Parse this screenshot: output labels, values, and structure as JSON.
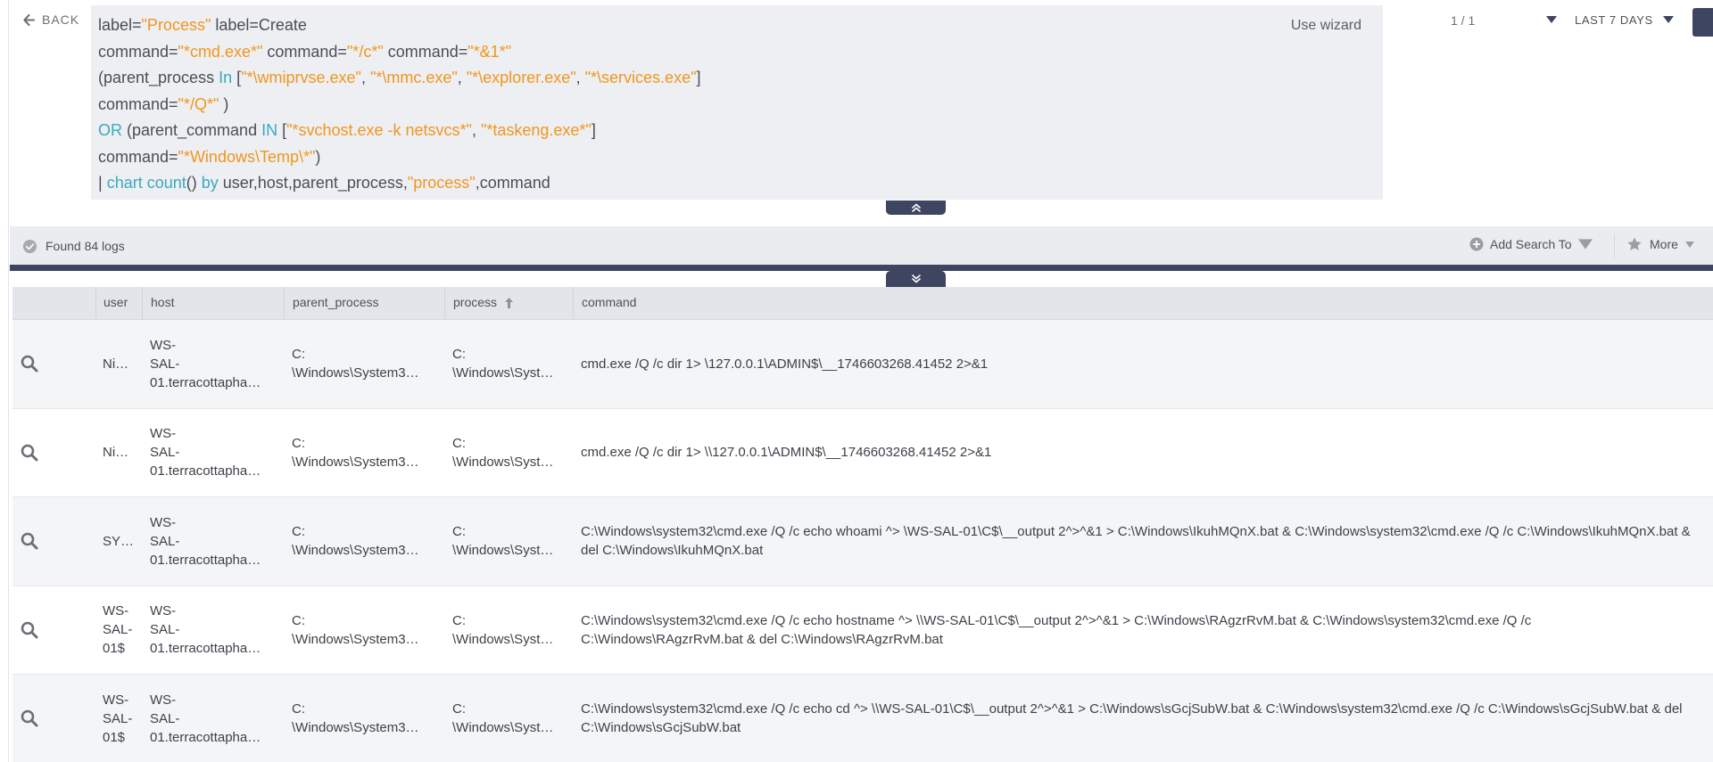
{
  "nav": {
    "back_label": "BACK"
  },
  "query": {
    "use_wizard_label": "Use wizard",
    "lines": [
      [
        {
          "t": "label=",
          "c": "plain"
        },
        {
          "t": "\"Process\"",
          "c": "str"
        },
        {
          "t": " label=Create",
          "c": "plain"
        }
      ],
      [
        {
          "t": "command=",
          "c": "plain"
        },
        {
          "t": "\"*cmd.exe*\"",
          "c": "str"
        },
        {
          "t": " command=",
          "c": "plain"
        },
        {
          "t": "\"*/c*\"",
          "c": "str"
        },
        {
          "t": " command=",
          "c": "plain"
        },
        {
          "t": "\"*&1*\"",
          "c": "str"
        }
      ],
      [
        {
          "t": "(parent_process ",
          "c": "plain"
        },
        {
          "t": "In",
          "c": "kw"
        },
        {
          "t": " [",
          "c": "plain"
        },
        {
          "t": "\"*\\wmiprvse.exe\"",
          "c": "str"
        },
        {
          "t": ", ",
          "c": "plain"
        },
        {
          "t": "\"*\\mmc.exe\"",
          "c": "str"
        },
        {
          "t": ", ",
          "c": "plain"
        },
        {
          "t": "\"*\\explorer.exe\"",
          "c": "str"
        },
        {
          "t": ", ",
          "c": "plain"
        },
        {
          "t": "\"*\\services.exe\"",
          "c": "str"
        },
        {
          "t": "]",
          "c": "plain"
        }
      ],
      [
        {
          "t": "command=",
          "c": "plain"
        },
        {
          "t": "\"*/Q*\"",
          "c": "str"
        },
        {
          "t": " )",
          "c": "plain"
        }
      ],
      [
        {
          "t": "OR",
          "c": "kw"
        },
        {
          "t": " (parent_command ",
          "c": "plain"
        },
        {
          "t": "IN",
          "c": "kw"
        },
        {
          "t": " [",
          "c": "plain"
        },
        {
          "t": "\"*svchost.exe -k netsvcs*\"",
          "c": "str"
        },
        {
          "t": ", ",
          "c": "plain"
        },
        {
          "t": "\"*taskeng.exe*\"",
          "c": "str"
        },
        {
          "t": "]",
          "c": "plain"
        }
      ],
      [
        {
          "t": "command=",
          "c": "plain"
        },
        {
          "t": "\"*Windows\\Temp\\*\"",
          "c": "str"
        },
        {
          "t": ")",
          "c": "plain"
        }
      ],
      [
        {
          "t": "| ",
          "c": "plain"
        },
        {
          "t": "chart count",
          "c": "kw"
        },
        {
          "t": "() ",
          "c": "plain"
        },
        {
          "t": "by",
          "c": "kw"
        },
        {
          "t": " user,host,parent_process,",
          "c": "plain"
        },
        {
          "t": "\"process\"",
          "c": "str"
        },
        {
          "t": ",command",
          "c": "plain"
        }
      ]
    ]
  },
  "pager": {
    "label": "1 / 1"
  },
  "time_range": {
    "label": "LAST 7 DAYS"
  },
  "results": {
    "found_label": "Found 84 logs",
    "add_search_label": "Add Search To",
    "more_label": "More"
  },
  "table": {
    "columns": [
      "",
      "user",
      "host",
      "parent_process",
      "process",
      "command"
    ],
    "sorted_column": "process",
    "rows": [
      {
        "user": "Ni…",
        "host": "WS-\nSAL-\n01.terracottapha…",
        "parent_process": "C:\n\\Windows\\System3…",
        "process": "C:\n\\Windows\\Syst…",
        "command": "cmd.exe /Q /c dir 1> \\127.0.0.1\\ADMIN$\\__1746603268.41452 2>&1"
      },
      {
        "user": "Ni…",
        "host": "WS-\nSAL-\n01.terracottapha…",
        "parent_process": "C:\n\\Windows\\System3…",
        "process": "C:\n\\Windows\\Syst…",
        "command": "cmd.exe /Q /c dir 1> \\\\127.0.0.1\\ADMIN$\\__1746603268.41452 2>&1"
      },
      {
        "user": "SY…",
        "host": "WS-\nSAL-\n01.terracottapha…",
        "parent_process": "C:\n\\Windows\\System3…",
        "process": "C:\n\\Windows\\Syst…",
        "command": "C:\\Windows\\system32\\cmd.exe /Q /c echo whoami ^> \\WS-SAL-01\\C$\\__output 2^>^&1 > C:\\Windows\\IkuhMQnX.bat & C:\\Windows\\system32\\cmd.exe /Q /c C:\\Windows\\IkuhMQnX.bat & del C:\\Windows\\IkuhMQnX.bat"
      },
      {
        "user": "WS-\nSAL-\n01$",
        "host": "WS-\nSAL-\n01.terracottapha…",
        "parent_process": "C:\n\\Windows\\System3…",
        "process": "C:\n\\Windows\\Syst…",
        "command": "C:\\Windows\\system32\\cmd.exe /Q /c echo hostname ^> \\\\WS-SAL-01\\C$\\__output 2^>^&1 > C:\\Windows\\RAgzrRvM.bat & C:\\Windows\\system32\\cmd.exe /Q /c C:\\Windows\\RAgzrRvM.bat & del C:\\Windows\\RAgzrRvM.bat"
      },
      {
        "user": "WS-\nSAL-\n01$",
        "host": "WS-\nSAL-\n01.terracottapha…",
        "parent_process": "C:\n\\Windows\\System3…",
        "process": "C:\n\\Windows\\Syst…",
        "command": "C:\\Windows\\system32\\cmd.exe /Q /c echo cd ^> \\\\WS-SAL-01\\C$\\__output 2^>^&1 > C:\\Windows\\sGcjSubW.bat & C:\\Windows\\system32\\cmd.exe /Q /c C:\\Windows\\sGcjSubW.bat & del C:\\Windows\\sGcjSubW.bat"
      }
    ]
  },
  "colors": {
    "accent_dark": "#3e4561",
    "query_string": "#f0961e",
    "query_keyword": "#3aa9bf"
  },
  "icons": {
    "back": "arrow-left-icon",
    "found": "check-circle-icon",
    "add_search": "plus-circle-icon",
    "more": "star-icon",
    "row_action": "magnifier-icon",
    "sort": "arrow-up-icon",
    "collapse_up": "double-chevron-up-icon",
    "collapse_down": "double-chevron-down-icon"
  }
}
